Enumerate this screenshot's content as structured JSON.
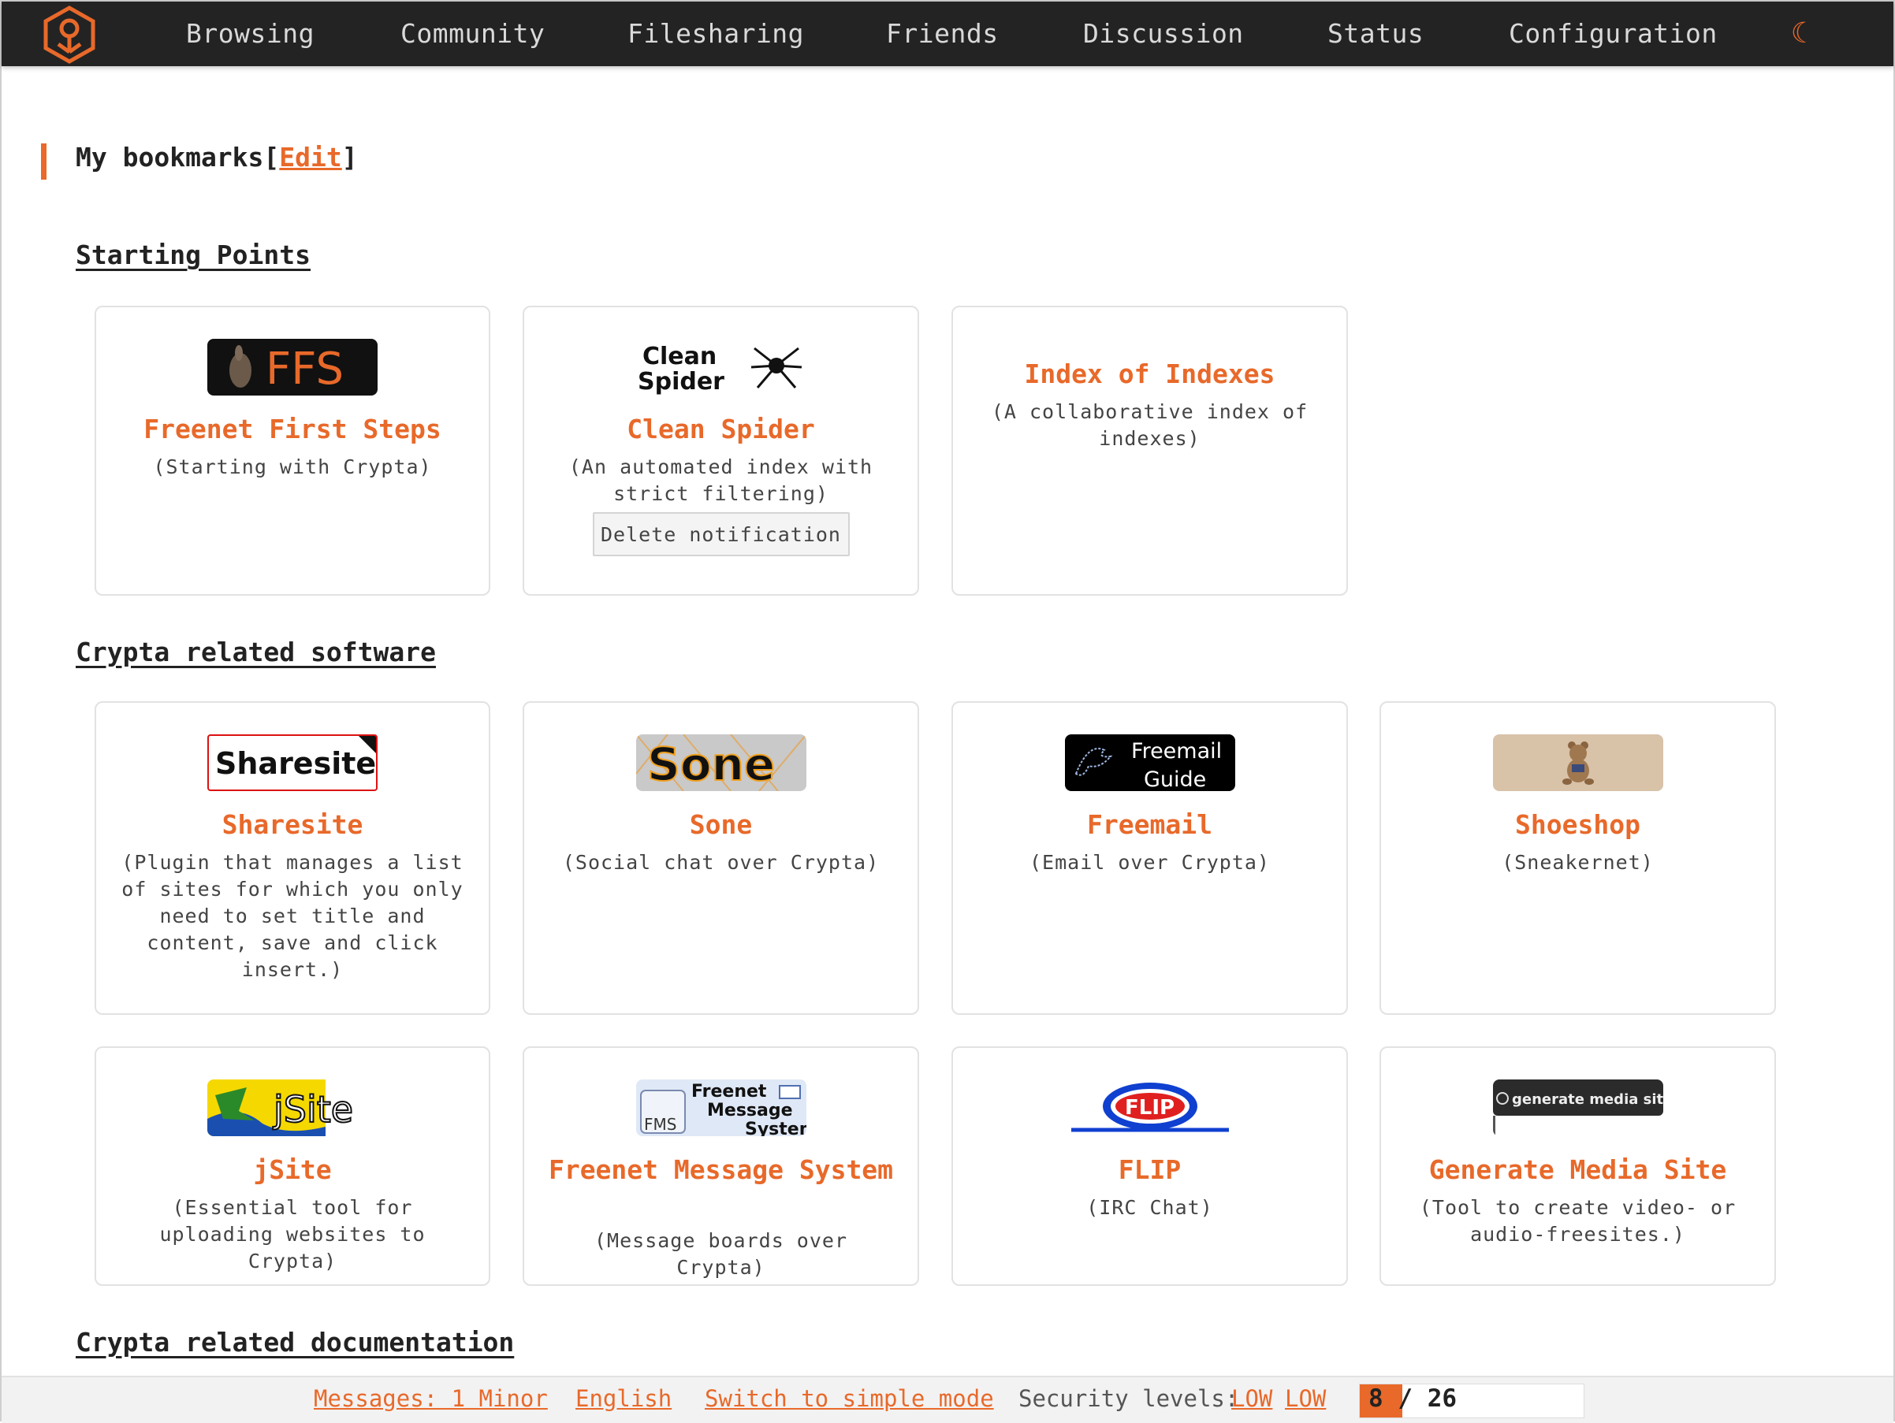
{
  "nav": {
    "items": [
      "Browsing",
      "Community",
      "Filesharing",
      "Friends",
      "Discussion",
      "Status",
      "Configuration"
    ],
    "theme_icon": "moon-icon",
    "logo_icon": "freenet-logo-icon"
  },
  "bookmarks": {
    "title": "My bookmarks",
    "open_bracket": "[",
    "edit_label": "Edit",
    "close_bracket": "]"
  },
  "sections": {
    "starting_points": "Starting Points",
    "software": "Crypta related software",
    "documentation": "Crypta related documentation"
  },
  "cards": {
    "ffs": {
      "title": "Freenet First Steps",
      "desc": "(Starting with Crypta)",
      "logo_text": "FFS"
    },
    "clean_spider": {
      "title": "Clean Spider",
      "desc": "(An automated index with strict filtering)",
      "logo_text_1": "Clean",
      "logo_text_2": "Spider",
      "button": "Delete notification"
    },
    "index": {
      "title": "Index of Indexes",
      "desc": "(A collaborative index of indexes)"
    },
    "sharesite": {
      "title": "Sharesite",
      "desc": "(Plugin that manages a list of sites for which you only need to set title and content, save and click insert.)",
      "logo_text": "Sharesite"
    },
    "sone": {
      "title": "Sone",
      "desc": "(Social chat over Crypta)",
      "logo_text": "Sone"
    },
    "freemail": {
      "title": "Freemail",
      "desc": "(Email over Crypta)",
      "logo_text_1": "Freemail",
      "logo_text_2": "Guide"
    },
    "shoeshop": {
      "title": "Shoeshop",
      "desc": "(Sneakernet)"
    },
    "jsite": {
      "title": "jSite",
      "desc": "(Essential tool for uploading websites to Crypta)",
      "logo_text": "jSite"
    },
    "fms": {
      "title": "Freenet Message System",
      "desc": "(Message boards over Crypta)",
      "logo_text_1": "Freenet",
      "logo_text_2": "Message",
      "logo_text_3": "System",
      "logo_text_4": "FMS"
    },
    "flip": {
      "title": "FLIP",
      "desc": "(IRC Chat)",
      "logo_text": "FLIP"
    },
    "gms": {
      "title": "Generate Media Site",
      "desc": "(Tool to create video- or audio-freesites.)",
      "logo_text": "generate media site"
    }
  },
  "footer": {
    "messages": "Messages: 1 Minor",
    "language": "English",
    "mode": "Switch to simple mode",
    "security_label": "Security levels:",
    "security_1": "LOW",
    "security_2": "LOW",
    "peers_connected": "8",
    "peers_sep": "/",
    "peers_total": "26",
    "peers_fraction": 0.19,
    "accent": "#e8692a"
  }
}
